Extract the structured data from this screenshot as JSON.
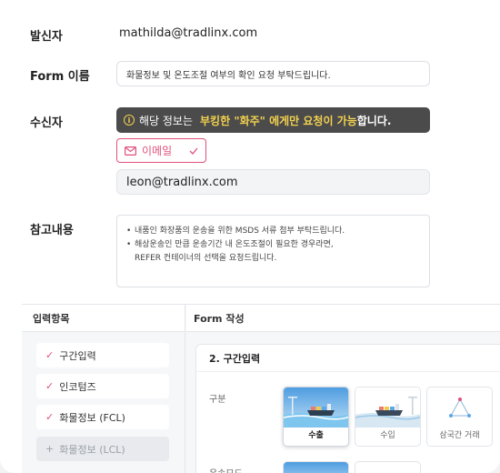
{
  "sender": {
    "label": "발신자",
    "value": "mathilda@tradlinx.com"
  },
  "form_name": {
    "label": "Form 이름",
    "value": "화물정보 및 온도조절 여부의 확인 요청 부탁드립니다."
  },
  "recipient": {
    "label": "수신자",
    "notice_prefix": "해당 정보는",
    "notice_highlight": "부킹한 \"화주\" 에게만 요청이 가능",
    "notice_suffix": "합니다.",
    "type_selected": "이메일",
    "email_value": "leon@tradlinx.com"
  },
  "memo": {
    "label": "참고내용",
    "line1": "내품인 화장품의 운송을 위한 MSDS 서류 첨부 부탁드립니다.",
    "line2": "해상운송인 만큼 운송기간 내 온도조절이 필요한 경우라면,",
    "line3": "REFER 컨테이너의 선택을 요청드립니다."
  },
  "input_items": {
    "header": "입력항목",
    "items": [
      {
        "label": "구간입력",
        "checked": true
      },
      {
        "label": "인코텀즈",
        "checked": true
      },
      {
        "label": "화물정보 (FCL)",
        "checked": true
      },
      {
        "label": "화물정보 (LCL)",
        "checked": false
      }
    ]
  },
  "form_write": {
    "header": "Form 작성",
    "section_title": "2. 구간입력",
    "division_label": "구분",
    "options": [
      {
        "label": "수출",
        "icon": "export-ship-icon"
      },
      {
        "label": "수입",
        "icon": "import-ship-icon"
      },
      {
        "label": "삼국간 거래",
        "icon": "triangle-trade-icon"
      }
    ],
    "transport_label": "운송모드"
  },
  "colors": {
    "accent": "#e0507a",
    "notice_bg": "#4b4b4b",
    "notice_highlight": "#f3d24f"
  }
}
